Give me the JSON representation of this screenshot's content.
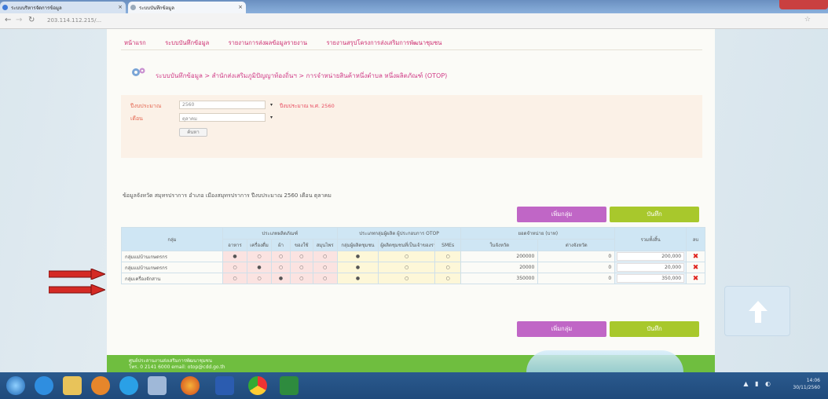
{
  "browser": {
    "tab1_title": "ระบบบริหารจัดการข้อมูล",
    "tab2_title": "ระบบบันทึกข้อมูล",
    "url": "203.114.112.215/...",
    "colors": {
      "tabbar": "#7ba0cc",
      "close": "#c94040"
    }
  },
  "topnav": [
    "หน้าแรก",
    "ระบบบันทึกข้อมูล",
    "รายงานการส่งผลข้อมูลรายงาน",
    "รายงานสรุปโครงการส่งเสริมการพัฒนาชุมชน"
  ],
  "breadcrumb": "ระบบบันทึกข้อมูล > สำนักส่งเสริมภูมิปัญญาท้องถิ่นฯ > การจำหน่ายสินค้าหนึ่งตำบล หนึ่งผลิตภัณฑ์ (OTOP)",
  "filter": {
    "year_label": "ปีงบประมาณ",
    "year_value": "2560",
    "month_label": "เดือน",
    "month_value": "ตุลาคม",
    "warning": "ปีงบประมาณ พ.ศ. 2560",
    "search_button": "ค้นหา"
  },
  "subtitle": "ข้อมูลจังหวัด สมุทรปราการ อำเภอ เมืองสมุทรปราการ ปีงบประมาณ 2560 เดือน ตุลาคม",
  "actions": {
    "add_label": "เพิ่มกลุ่ม",
    "save_label": "บันทึก"
  },
  "table": {
    "group_header": "กลุ่ม",
    "section_headers": [
      "ประเภทผลิตภัณฑ์",
      "ประเภทกลุ่มผู้ผลิต ผู้ประกอบการ OTOP",
      "ยอดจำหน่าย (บาท)",
      "รวมทั้งสิ้น",
      "ลบ"
    ],
    "product_types": [
      "อาหาร",
      "เครื่องดื่ม",
      "ผ้า",
      "ของใช้",
      "สมุนไพร"
    ],
    "producer_types": [
      "กลุ่มผู้ผลิตชุมชน",
      "ผู้ผลิตชุมชนที่เป็นเจ้าของรายเดียว",
      "SMEs"
    ],
    "sales_headers": [
      "ในจังหวัด",
      "ต่างจังหวัด"
    ],
    "rows": [
      {
        "name": "กลุ่มแม่บ้านเกษตรกร",
        "in_province": "200000",
        "out_province": "0",
        "total": "200,000"
      },
      {
        "name": "กลุ่มแม่บ้านเกษตรกร",
        "in_province": "20000",
        "out_province": "0",
        "total": "20,000"
      },
      {
        "name": "กลุ่มเครื่องจักสาน",
        "in_province": "350000",
        "out_province": "0",
        "total": "350,000"
      }
    ]
  },
  "footer": {
    "line1": "ศูนย์ประสานงานส่งเสริมการพัฒนาชุมชน",
    "line2": "โทร. 0 2141 6000 email: otop@cdd.go.th"
  },
  "clock": {
    "time": "14:06",
    "date": "30/11/2560"
  },
  "icons": [
    "windows-start-icon",
    "ie-icon",
    "folder-icon",
    "media-icon",
    "skype-icon",
    "explorer-icon",
    "firefox-icon",
    "word-icon",
    "chrome-icon",
    "excel-icon"
  ],
  "accent_colors": {
    "pink": "#cc2a6e",
    "add_button": "#c066c6",
    "save_button": "#a8c82c",
    "footer": "#6fbe3f",
    "arrow": "#d42a24"
  }
}
